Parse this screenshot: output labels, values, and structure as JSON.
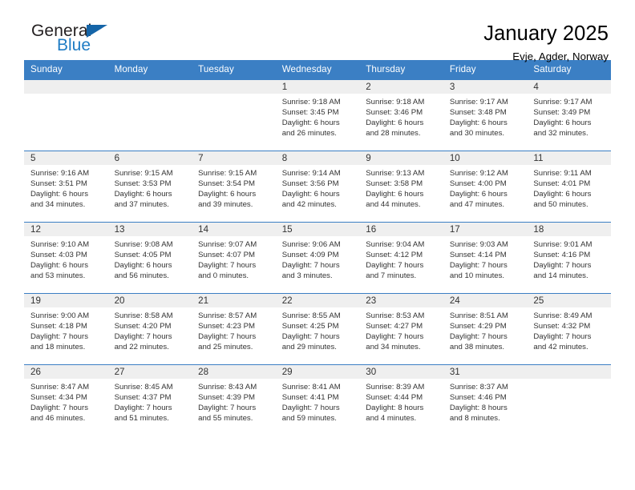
{
  "logo": {
    "name_top": "General",
    "name_bottom": "Blue",
    "triangle_color": "#1565a8",
    "blue_text_color": "#1f7cc4"
  },
  "header": {
    "title": "January 2025",
    "subtitle": "Evje, Agder, Norway"
  },
  "theme": {
    "header_row_bg": "#3b7fc4",
    "day_band_bg": "#efefef",
    "cell_border": "#3b7fc4",
    "text": "#333333"
  },
  "weekdays": [
    "Sunday",
    "Monday",
    "Tuesday",
    "Wednesday",
    "Thursday",
    "Friday",
    "Saturday"
  ],
  "weeks": [
    [
      {
        "day": "",
        "sunrise": "",
        "sunset": "",
        "daylight_line1": "",
        "daylight_line2": ""
      },
      {
        "day": "",
        "sunrise": "",
        "sunset": "",
        "daylight_line1": "",
        "daylight_line2": ""
      },
      {
        "day": "",
        "sunrise": "",
        "sunset": "",
        "daylight_line1": "",
        "daylight_line2": ""
      },
      {
        "day": "1",
        "sunrise": "Sunrise: 9:18 AM",
        "sunset": "Sunset: 3:45 PM",
        "daylight_line1": "Daylight: 6 hours",
        "daylight_line2": "and 26 minutes."
      },
      {
        "day": "2",
        "sunrise": "Sunrise: 9:18 AM",
        "sunset": "Sunset: 3:46 PM",
        "daylight_line1": "Daylight: 6 hours",
        "daylight_line2": "and 28 minutes."
      },
      {
        "day": "3",
        "sunrise": "Sunrise: 9:17 AM",
        "sunset": "Sunset: 3:48 PM",
        "daylight_line1": "Daylight: 6 hours",
        "daylight_line2": "and 30 minutes."
      },
      {
        "day": "4",
        "sunrise": "Sunrise: 9:17 AM",
        "sunset": "Sunset: 3:49 PM",
        "daylight_line1": "Daylight: 6 hours",
        "daylight_line2": "and 32 minutes."
      }
    ],
    [
      {
        "day": "5",
        "sunrise": "Sunrise: 9:16 AM",
        "sunset": "Sunset: 3:51 PM",
        "daylight_line1": "Daylight: 6 hours",
        "daylight_line2": "and 34 minutes."
      },
      {
        "day": "6",
        "sunrise": "Sunrise: 9:15 AM",
        "sunset": "Sunset: 3:53 PM",
        "daylight_line1": "Daylight: 6 hours",
        "daylight_line2": "and 37 minutes."
      },
      {
        "day": "7",
        "sunrise": "Sunrise: 9:15 AM",
        "sunset": "Sunset: 3:54 PM",
        "daylight_line1": "Daylight: 6 hours",
        "daylight_line2": "and 39 minutes."
      },
      {
        "day": "8",
        "sunrise": "Sunrise: 9:14 AM",
        "sunset": "Sunset: 3:56 PM",
        "daylight_line1": "Daylight: 6 hours",
        "daylight_line2": "and 42 minutes."
      },
      {
        "day": "9",
        "sunrise": "Sunrise: 9:13 AM",
        "sunset": "Sunset: 3:58 PM",
        "daylight_line1": "Daylight: 6 hours",
        "daylight_line2": "and 44 minutes."
      },
      {
        "day": "10",
        "sunrise": "Sunrise: 9:12 AM",
        "sunset": "Sunset: 4:00 PM",
        "daylight_line1": "Daylight: 6 hours",
        "daylight_line2": "and 47 minutes."
      },
      {
        "day": "11",
        "sunrise": "Sunrise: 9:11 AM",
        "sunset": "Sunset: 4:01 PM",
        "daylight_line1": "Daylight: 6 hours",
        "daylight_line2": "and 50 minutes."
      }
    ],
    [
      {
        "day": "12",
        "sunrise": "Sunrise: 9:10 AM",
        "sunset": "Sunset: 4:03 PM",
        "daylight_line1": "Daylight: 6 hours",
        "daylight_line2": "and 53 minutes."
      },
      {
        "day": "13",
        "sunrise": "Sunrise: 9:08 AM",
        "sunset": "Sunset: 4:05 PM",
        "daylight_line1": "Daylight: 6 hours",
        "daylight_line2": "and 56 minutes."
      },
      {
        "day": "14",
        "sunrise": "Sunrise: 9:07 AM",
        "sunset": "Sunset: 4:07 PM",
        "daylight_line1": "Daylight: 7 hours",
        "daylight_line2": "and 0 minutes."
      },
      {
        "day": "15",
        "sunrise": "Sunrise: 9:06 AM",
        "sunset": "Sunset: 4:09 PM",
        "daylight_line1": "Daylight: 7 hours",
        "daylight_line2": "and 3 minutes."
      },
      {
        "day": "16",
        "sunrise": "Sunrise: 9:04 AM",
        "sunset": "Sunset: 4:12 PM",
        "daylight_line1": "Daylight: 7 hours",
        "daylight_line2": "and 7 minutes."
      },
      {
        "day": "17",
        "sunrise": "Sunrise: 9:03 AM",
        "sunset": "Sunset: 4:14 PM",
        "daylight_line1": "Daylight: 7 hours",
        "daylight_line2": "and 10 minutes."
      },
      {
        "day": "18",
        "sunrise": "Sunrise: 9:01 AM",
        "sunset": "Sunset: 4:16 PM",
        "daylight_line1": "Daylight: 7 hours",
        "daylight_line2": "and 14 minutes."
      }
    ],
    [
      {
        "day": "19",
        "sunrise": "Sunrise: 9:00 AM",
        "sunset": "Sunset: 4:18 PM",
        "daylight_line1": "Daylight: 7 hours",
        "daylight_line2": "and 18 minutes."
      },
      {
        "day": "20",
        "sunrise": "Sunrise: 8:58 AM",
        "sunset": "Sunset: 4:20 PM",
        "daylight_line1": "Daylight: 7 hours",
        "daylight_line2": "and 22 minutes."
      },
      {
        "day": "21",
        "sunrise": "Sunrise: 8:57 AM",
        "sunset": "Sunset: 4:23 PM",
        "daylight_line1": "Daylight: 7 hours",
        "daylight_line2": "and 25 minutes."
      },
      {
        "day": "22",
        "sunrise": "Sunrise: 8:55 AM",
        "sunset": "Sunset: 4:25 PM",
        "daylight_line1": "Daylight: 7 hours",
        "daylight_line2": "and 29 minutes."
      },
      {
        "day": "23",
        "sunrise": "Sunrise: 8:53 AM",
        "sunset": "Sunset: 4:27 PM",
        "daylight_line1": "Daylight: 7 hours",
        "daylight_line2": "and 34 minutes."
      },
      {
        "day": "24",
        "sunrise": "Sunrise: 8:51 AM",
        "sunset": "Sunset: 4:29 PM",
        "daylight_line1": "Daylight: 7 hours",
        "daylight_line2": "and 38 minutes."
      },
      {
        "day": "25",
        "sunrise": "Sunrise: 8:49 AM",
        "sunset": "Sunset: 4:32 PM",
        "daylight_line1": "Daylight: 7 hours",
        "daylight_line2": "and 42 minutes."
      }
    ],
    [
      {
        "day": "26",
        "sunrise": "Sunrise: 8:47 AM",
        "sunset": "Sunset: 4:34 PM",
        "daylight_line1": "Daylight: 7 hours",
        "daylight_line2": "and 46 minutes."
      },
      {
        "day": "27",
        "sunrise": "Sunrise: 8:45 AM",
        "sunset": "Sunset: 4:37 PM",
        "daylight_line1": "Daylight: 7 hours",
        "daylight_line2": "and 51 minutes."
      },
      {
        "day": "28",
        "sunrise": "Sunrise: 8:43 AM",
        "sunset": "Sunset: 4:39 PM",
        "daylight_line1": "Daylight: 7 hours",
        "daylight_line2": "and 55 minutes."
      },
      {
        "day": "29",
        "sunrise": "Sunrise: 8:41 AM",
        "sunset": "Sunset: 4:41 PM",
        "daylight_line1": "Daylight: 7 hours",
        "daylight_line2": "and 59 minutes."
      },
      {
        "day": "30",
        "sunrise": "Sunrise: 8:39 AM",
        "sunset": "Sunset: 4:44 PM",
        "daylight_line1": "Daylight: 8 hours",
        "daylight_line2": "and 4 minutes."
      },
      {
        "day": "31",
        "sunrise": "Sunrise: 8:37 AM",
        "sunset": "Sunset: 4:46 PM",
        "daylight_line1": "Daylight: 8 hours",
        "daylight_line2": "and 8 minutes."
      },
      {
        "day": "",
        "sunrise": "",
        "sunset": "",
        "daylight_line1": "",
        "daylight_line2": ""
      }
    ]
  ]
}
